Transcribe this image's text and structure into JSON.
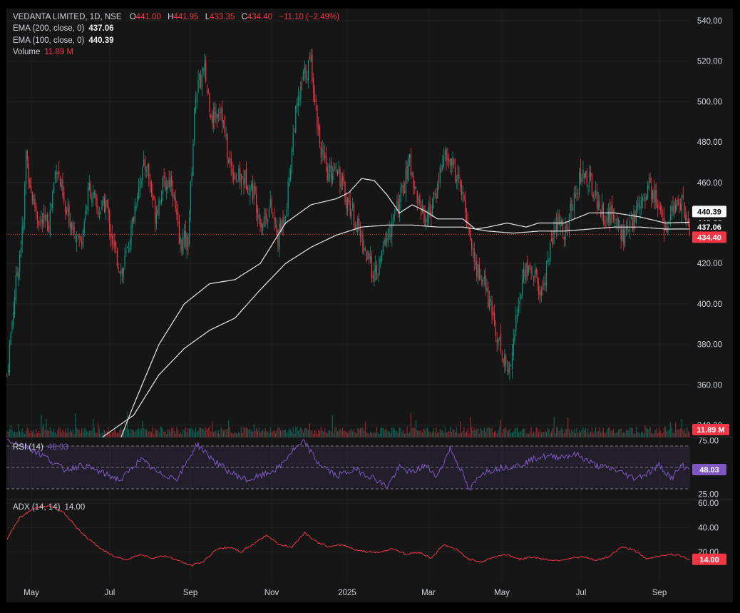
{
  "header": {
    "symbol": "VEDANTA LIMITED, 1D, NSE",
    "o_label": "O",
    "o_value": "441.00",
    "h_label": "H",
    "h_value": "441.95",
    "l_label": "L",
    "l_value": "433.35",
    "c_label": "C",
    "c_value": "434.40",
    "change": "−11.10 (−2.49%)"
  },
  "indicators": {
    "ema200_label": "EMA (200, close, 0)",
    "ema200_value": "437.06",
    "ema100_label": "EMA (100, close, 0)",
    "ema100_value": "440.39",
    "volume_label": "Volume",
    "volume_value": "11.89 M",
    "rsi_label": "RSI (14)",
    "rsi_value": "48.03",
    "adx_label": "ADX (14, 14)",
    "adx_value": "14.00"
  },
  "colors": {
    "up": "#089981",
    "down": "#f23645",
    "rsi": "#7e57c2",
    "adx": "#f23645",
    "ema": "#e8e8e8",
    "background": "#161616"
  },
  "chart_data": [
    {
      "type": "candlestick",
      "title": "VEDANTA LIMITED, 1D, NSE",
      "x_ticks": [
        "May",
        "Jul",
        "Sep",
        "Nov",
        "2025",
        "Mar",
        "May",
        "Jul",
        "Sep"
      ],
      "y_ticks": [
        "540.00",
        "520.00",
        "500.00",
        "480.00",
        "460.00",
        "440.00",
        "420.00",
        "400.00",
        "380.00",
        "360.00",
        "340.00"
      ],
      "ylim": [
        334,
        546
      ],
      "price_labels": [
        "440.39",
        "437.06",
        "434.40"
      ],
      "volume_label": "11.89 M",
      "close_path": [
        [
          0,
          365
        ],
        [
          6,
          405
        ],
        [
          13,
          440
        ],
        [
          15,
          475
        ],
        [
          19,
          455
        ],
        [
          26,
          440
        ],
        [
          33,
          440
        ],
        [
          39,
          470
        ],
        [
          46,
          445
        ],
        [
          52,
          440
        ],
        [
          58,
          430
        ],
        [
          65,
          458
        ],
        [
          72,
          445
        ],
        [
          78,
          450
        ],
        [
          84,
          428
        ],
        [
          91,
          415
        ],
        [
          97,
          432
        ],
        [
          104,
          460
        ],
        [
          110,
          470
        ],
        [
          117,
          445
        ],
        [
          123,
          458
        ],
        [
          130,
          462
        ],
        [
          136,
          430
        ],
        [
          143,
          432
        ],
        [
          149,
          505
        ],
        [
          156,
          515
        ],
        [
          162,
          492
        ],
        [
          169,
          498
        ],
        [
          175,
          470
        ],
        [
          182,
          462
        ],
        [
          188,
          462
        ],
        [
          195,
          455
        ],
        [
          201,
          440
        ],
        [
          208,
          448
        ],
        [
          214,
          432
        ],
        [
          221,
          450
        ],
        [
          227,
          490
        ],
        [
          234,
          512
        ],
        [
          240,
          520
        ],
        [
          247,
          480
        ],
        [
          253,
          462
        ],
        [
          260,
          470
        ],
        [
          266,
          455
        ],
        [
          273,
          445
        ],
        [
          279,
          434
        ],
        [
          286,
          420
        ],
        [
          292,
          413
        ],
        [
          299,
          432
        ],
        [
          305,
          440
        ],
        [
          312,
          455
        ],
        [
          318,
          470
        ],
        [
          325,
          450
        ],
        [
          331,
          442
        ],
        [
          338,
          452
        ],
        [
          344,
          472
        ],
        [
          351,
          470
        ],
        [
          357,
          460
        ],
        [
          364,
          440
        ],
        [
          370,
          418
        ],
        [
          377,
          410
        ],
        [
          383,
          395
        ],
        [
          390,
          378
        ],
        [
          396,
          366
        ],
        [
          403,
          395
        ],
        [
          409,
          418
        ],
        [
          416,
          415
        ],
        [
          422,
          404
        ],
        [
          429,
          428
        ],
        [
          435,
          440
        ],
        [
          442,
          435
        ],
        [
          448,
          455
        ],
        [
          455,
          465
        ],
        [
          461,
          460
        ],
        [
          468,
          448
        ],
        [
          474,
          442
        ],
        [
          481,
          445
        ],
        [
          487,
          432
        ],
        [
          494,
          440
        ],
        [
          500,
          452
        ],
        [
          507,
          458
        ],
        [
          513,
          450
        ],
        [
          520,
          438
        ],
        [
          526,
          445
        ],
        [
          533,
          452
        ],
        [
          539,
          434
        ]
      ],
      "ema100": [
        [
          90,
          334
        ],
        [
          100,
          350
        ],
        [
          120,
          380
        ],
        [
          140,
          400
        ],
        [
          160,
          410
        ],
        [
          180,
          412
        ],
        [
          200,
          420
        ],
        [
          220,
          440
        ],
        [
          240,
          449
        ],
        [
          260,
          452
        ],
        [
          270,
          455
        ],
        [
          280,
          462
        ],
        [
          290,
          461
        ],
        [
          300,
          454
        ],
        [
          310,
          445
        ],
        [
          320,
          449
        ],
        [
          330,
          446
        ],
        [
          340,
          442
        ],
        [
          360,
          442
        ],
        [
          370,
          437
        ],
        [
          380,
          438
        ],
        [
          395,
          440
        ],
        [
          410,
          438
        ],
        [
          420,
          440
        ],
        [
          440,
          440
        ],
        [
          460,
          445
        ],
        [
          480,
          445
        ],
        [
          500,
          443
        ],
        [
          520,
          440
        ],
        [
          539,
          440.39
        ]
      ],
      "ema200": [
        [
          75,
          334
        ],
        [
          100,
          345
        ],
        [
          120,
          365
        ],
        [
          140,
          378
        ],
        [
          160,
          387
        ],
        [
          180,
          393
        ],
        [
          200,
          407
        ],
        [
          220,
          420
        ],
        [
          240,
          428
        ],
        [
          260,
          434
        ],
        [
          280,
          438
        ],
        [
          300,
          439
        ],
        [
          320,
          439
        ],
        [
          340,
          438
        ],
        [
          360,
          438
        ],
        [
          380,
          436
        ],
        [
          400,
          435
        ],
        [
          420,
          436
        ],
        [
          440,
          436
        ],
        [
          460,
          437
        ],
        [
          480,
          438
        ],
        [
          500,
          438
        ],
        [
          520,
          437
        ],
        [
          539,
          437.06
        ]
      ]
    },
    {
      "type": "line",
      "title": "RSI (14)",
      "y_ticks": [
        "75.00",
        "25.00"
      ],
      "band": [
        30,
        70
      ],
      "ylim": [
        20,
        78
      ],
      "last_label": "48.03",
      "values": [
        [
          0,
          76
        ],
        [
          15,
          70
        ],
        [
          30,
          60
        ],
        [
          45,
          48
        ],
        [
          60,
          52
        ],
        [
          75,
          45
        ],
        [
          90,
          38
        ],
        [
          105,
          58
        ],
        [
          120,
          44
        ],
        [
          135,
          40
        ],
        [
          150,
          72
        ],
        [
          160,
          60
        ],
        [
          175,
          46
        ],
        [
          190,
          38
        ],
        [
          205,
          44
        ],
        [
          215,
          50
        ],
        [
          225,
          65
        ],
        [
          235,
          74
        ],
        [
          245,
          55
        ],
        [
          260,
          42
        ],
        [
          275,
          48
        ],
        [
          290,
          40
        ],
        [
          300,
          32
        ],
        [
          310,
          50
        ],
        [
          320,
          45
        ],
        [
          330,
          52
        ],
        [
          340,
          42
        ],
        [
          350,
          68
        ],
        [
          360,
          44
        ],
        [
          365,
          28
        ],
        [
          375,
          45
        ],
        [
          390,
          50
        ],
        [
          405,
          52
        ],
        [
          420,
          60
        ],
        [
          435,
          60
        ],
        [
          450,
          62
        ],
        [
          465,
          52
        ],
        [
          480,
          48
        ],
        [
          495,
          40
        ],
        [
          505,
          44
        ],
        [
          515,
          52
        ],
        [
          525,
          40
        ],
        [
          533,
          52
        ],
        [
          539,
          48.03
        ]
      ]
    },
    {
      "type": "line",
      "title": "ADX (14, 14)",
      "y_ticks": [
        "60.00",
        "40.00",
        "20.00"
      ],
      "ylim": [
        -6,
        63
      ],
      "last_label": "14.00",
      "values": [
        [
          0,
          31
        ],
        [
          10,
          48
        ],
        [
          20,
          55
        ],
        [
          28,
          58
        ],
        [
          36,
          57
        ],
        [
          45,
          52
        ],
        [
          55,
          40
        ],
        [
          65,
          30
        ],
        [
          75,
          22
        ],
        [
          85,
          16
        ],
        [
          95,
          14
        ],
        [
          105,
          18
        ],
        [
          115,
          15
        ],
        [
          125,
          17
        ],
        [
          135,
          13
        ],
        [
          145,
          9
        ],
        [
          155,
          12
        ],
        [
          165,
          22
        ],
        [
          175,
          24
        ],
        [
          185,
          20
        ],
        [
          195,
          27
        ],
        [
          205,
          34
        ],
        [
          215,
          26
        ],
        [
          225,
          24
        ],
        [
          235,
          36
        ],
        [
          245,
          28
        ],
        [
          255,
          24
        ],
        [
          265,
          26
        ],
        [
          275,
          22
        ],
        [
          285,
          20
        ],
        [
          295,
          20
        ],
        [
          305,
          23
        ],
        [
          315,
          18
        ],
        [
          325,
          20
        ],
        [
          335,
          15
        ],
        [
          345,
          26
        ],
        [
          355,
          22
        ],
        [
          365,
          14
        ],
        [
          375,
          12
        ],
        [
          385,
          16
        ],
        [
          395,
          18
        ],
        [
          405,
          14
        ],
        [
          415,
          16
        ],
        [
          425,
          14
        ],
        [
          435,
          13
        ],
        [
          445,
          15
        ],
        [
          455,
          16
        ],
        [
          465,
          13
        ],
        [
          475,
          16
        ],
        [
          485,
          24
        ],
        [
          495,
          22
        ],
        [
          505,
          14
        ],
        [
          515,
          17
        ],
        [
          525,
          18
        ],
        [
          533,
          17
        ],
        [
          539,
          14
        ]
      ]
    }
  ]
}
